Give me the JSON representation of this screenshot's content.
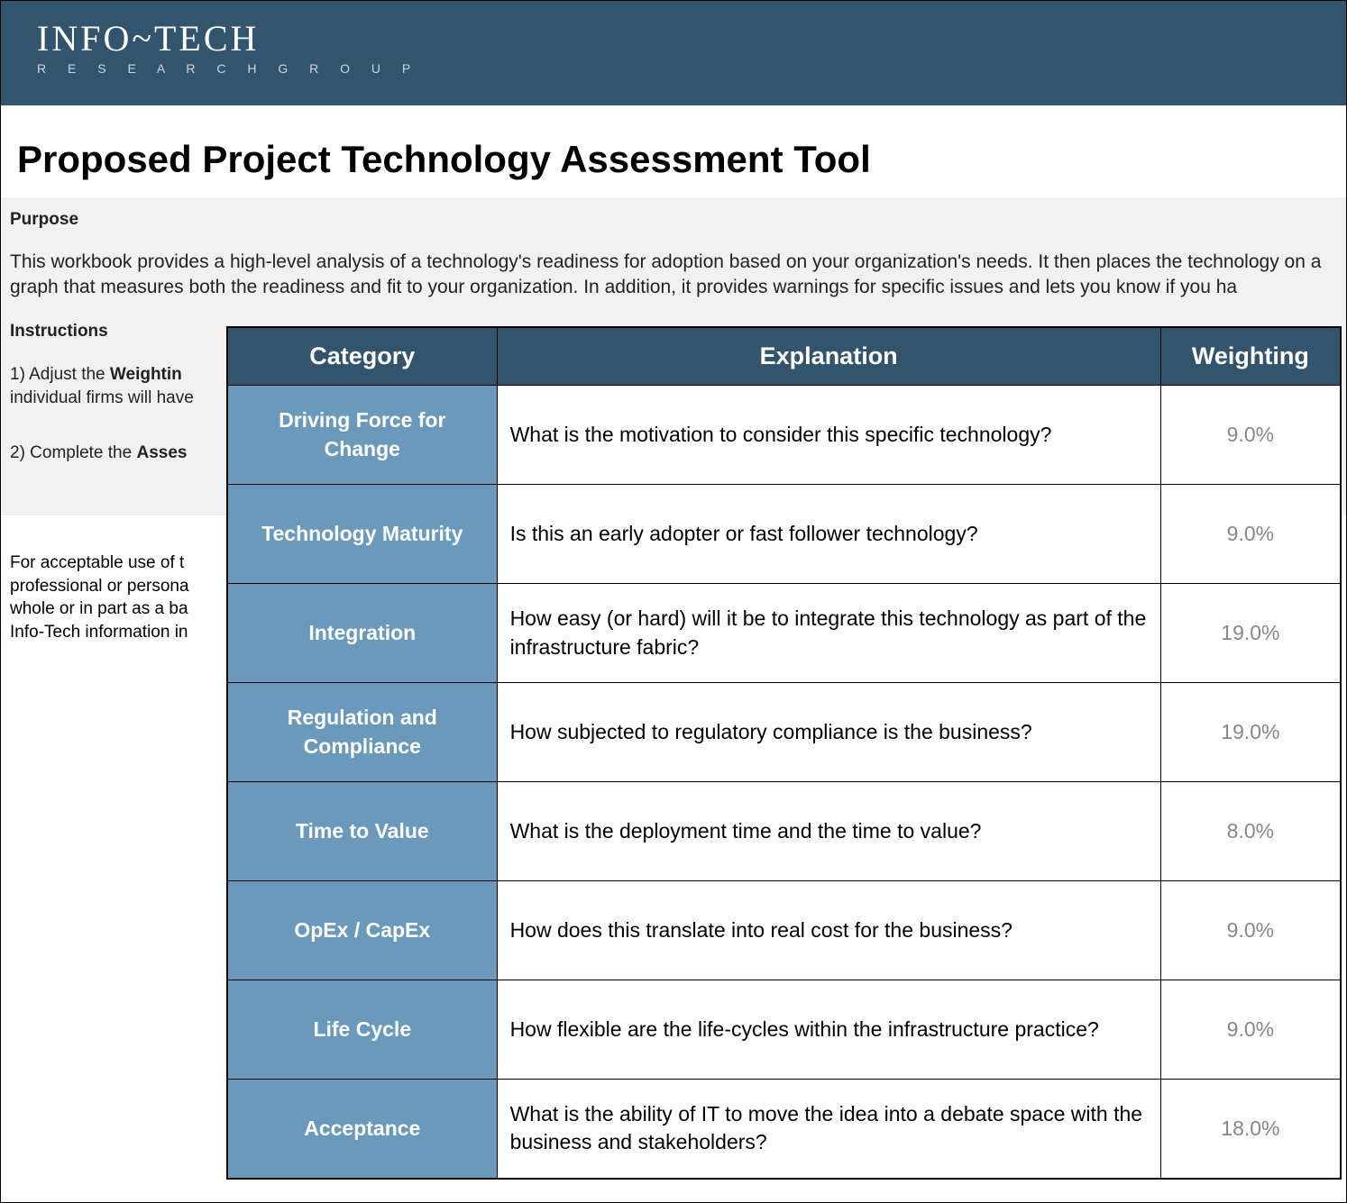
{
  "brand": {
    "main": "INFO~TECH",
    "sub": "R E S E A R C H   G R O U P"
  },
  "title": "Proposed Project Technology Assessment Tool",
  "purpose": {
    "heading": "Purpose",
    "body": "This workbook provides a high-level analysis of a technology's readiness for adoption based on your organization's needs. It then places the technology on a graph that measures both the readiness and fit to your organization. In addition, it provides warnings for specific issues and lets you know if you ha"
  },
  "instructions": {
    "heading": "Instructions",
    "line1_a": "1) Adjust the ",
    "line1_bold": "Weightin",
    "line1_b": "",
    "line2": "individual firms will have",
    "line3_a": "2) Complete the ",
    "line3_bold": "Asses"
  },
  "disclaimer": {
    "line1": "For acceptable use of t",
    "line2": "professional or persona",
    "line3": "whole or in part as a ba",
    "line4": "Info-Tech information in"
  },
  "table": {
    "headers": {
      "category": "Category",
      "explanation": "Explanation",
      "weighting": "Weighting"
    },
    "rows": [
      {
        "category": "Driving Force for Change",
        "explanation": "What is the motivation to consider this specific technology?",
        "weighting": "9.0%"
      },
      {
        "category": "Technology Maturity",
        "explanation": "Is this an early adopter or fast follower technology?",
        "weighting": "9.0%"
      },
      {
        "category": "Integration",
        "explanation": "How easy (or hard) will it be to integrate this technology as part of the infrastructure fabric?",
        "weighting": "19.0%"
      },
      {
        "category": "Regulation and Compliance",
        "explanation": "How subjected to regulatory compliance is the business?",
        "weighting": "19.0%"
      },
      {
        "category": "Time to Value",
        "explanation": "What is the deployment time and the time to value?",
        "weighting": "8.0%"
      },
      {
        "category": "OpEx / CapEx",
        "explanation": "How does this  translate into real cost for the business?",
        "weighting": "9.0%"
      },
      {
        "category": "Life Cycle",
        "explanation": "How flexible are the life-cycles within the infrastructure practice?",
        "weighting": "9.0%"
      },
      {
        "category": "Acceptance",
        "explanation": "What is the ability of IT to move the idea into a debate space with the business and stakeholders?",
        "weighting": "18.0%"
      }
    ]
  }
}
